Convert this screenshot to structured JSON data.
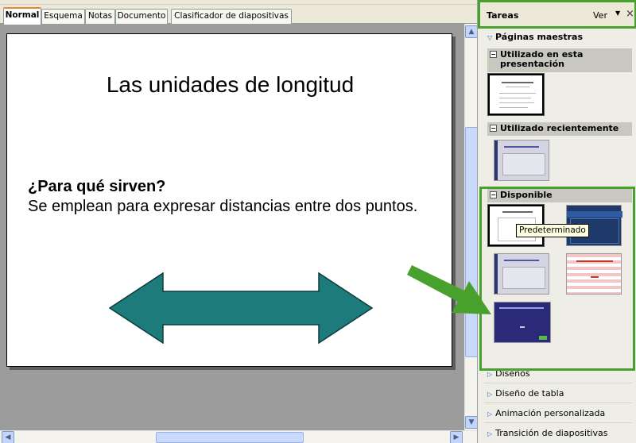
{
  "tabs": [
    "Normal",
    "Esquema",
    "Notas",
    "Documento",
    "Clasificador de diapositivas"
  ],
  "slide": {
    "title": "Las unidades de longitud",
    "heading": "¿Para qué sirven?",
    "body": "Se emplean para expresar distancias entre dos puntos."
  },
  "pane": {
    "title": "Tareas",
    "view_label": "Ver",
    "close": "×",
    "section_title": "Páginas maestras",
    "groups": {
      "used_in_presentation": "Utilizado en esta presentación",
      "recently_used": "Utilizado recientemente",
      "available": "Disponible"
    },
    "tooltip": "Predeterminado",
    "links": [
      "Diseños",
      "Diseño de tabla",
      "Animación personalizada",
      "Transición de diapositivas"
    ]
  },
  "colors": {
    "highlight_green": "#47a12c",
    "arrow_fill": "#1e7b7b",
    "active_tab_accent": "#e68b2c"
  },
  "icons": {
    "collapse": "minus-box-icon",
    "expand": "triangle-right-icon",
    "section": "triangle-down-icon"
  }
}
